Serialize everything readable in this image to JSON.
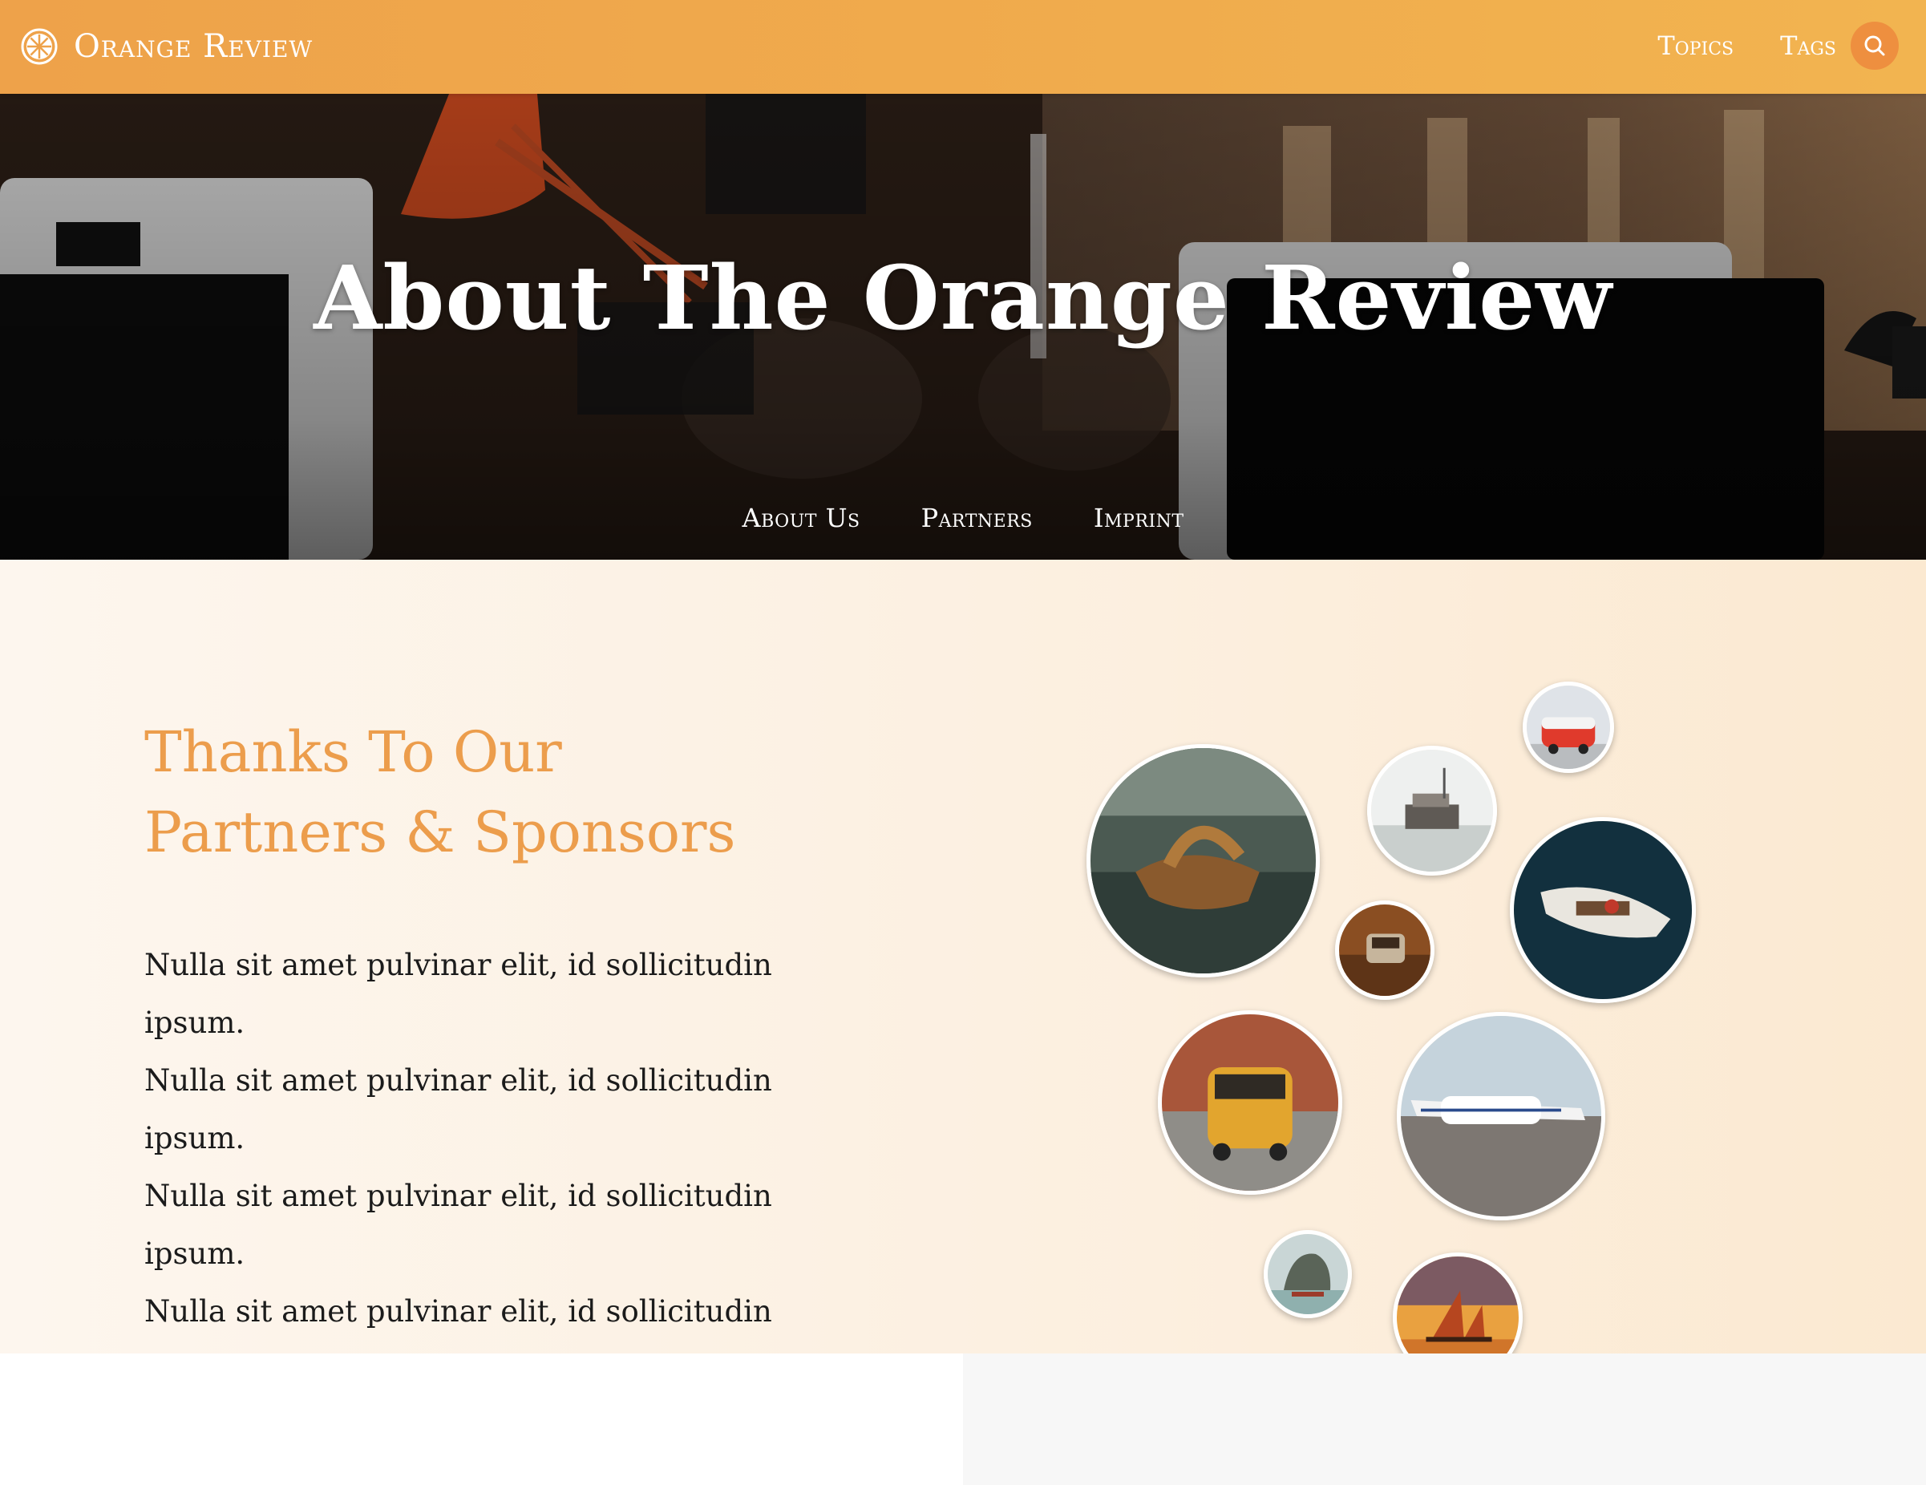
{
  "brand": {
    "name": "Orange Review",
    "icon": "orange-slice-icon"
  },
  "nav": {
    "topics": "Topics",
    "tags": "Tags",
    "search_icon": "search-icon"
  },
  "hero": {
    "title": "About The Orange Review",
    "tabs": [
      "About Us",
      "Partners",
      "Imprint"
    ]
  },
  "partners": {
    "title_line1": "Thanks To Our",
    "title_line2": "Partners & Sponsors",
    "paragraphs": [
      "Nulla sit amet pulvinar elit, id sollicitudin ipsum.",
      "Nulla sit amet pulvinar elit, id sollicitudin ipsum.",
      "Nulla sit amet pulvinar elit, id sollicitudin ipsum.",
      "Nulla sit amet pulvinar elit, id sollicitudin ipsum."
    ]
  },
  "colors": {
    "accent": "#ec9d4c",
    "nav_bg": "#f0ac4d",
    "search_btn": "#ee8f3f",
    "section_bg": "#fcefdf"
  }
}
